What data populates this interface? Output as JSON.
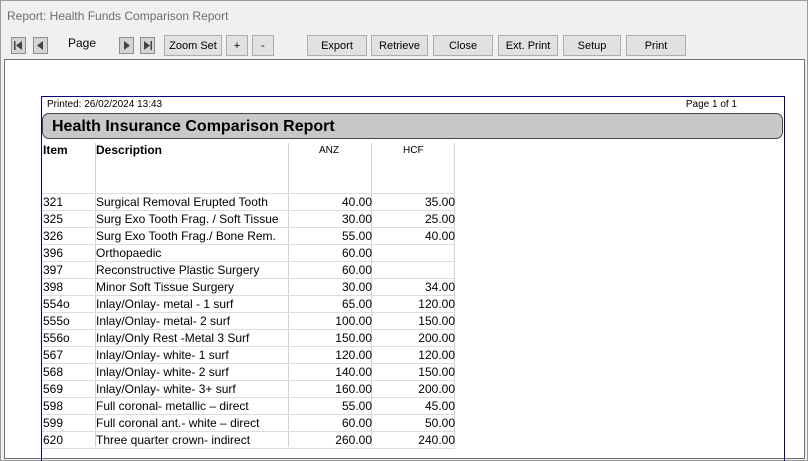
{
  "window": {
    "title": "Report: Health Funds Comparison Report"
  },
  "toolbar": {
    "page_label": "Page",
    "zoom_set": "Zoom Set",
    "zoom_in": "+",
    "zoom_out": "-",
    "export": "Export",
    "retrieve": "Retrieve",
    "close": "Close",
    "ext_print": "Ext. Print",
    "setup": "Setup",
    "print": "Print"
  },
  "report": {
    "printed": "Printed: 26/02/2024 13:43",
    "page_of": "Page 1 of 1",
    "title": "Health Insurance Comparison Report",
    "columns": {
      "item": "Item",
      "description": "Description",
      "anz": "ANZ",
      "hcf": "HCF"
    },
    "rows": [
      {
        "item": "321",
        "description": "Surgical Removal Erupted Tooth",
        "anz": "40.00",
        "hcf": "35.00"
      },
      {
        "item": "325",
        "description": "Surg Exo Tooth Frag. / Soft Tissue",
        "anz": "30.00",
        "hcf": "25.00"
      },
      {
        "item": "326",
        "description": "Surg Exo Tooth Frag./ Bone Rem.",
        "anz": "55.00",
        "hcf": "40.00"
      },
      {
        "item": "396",
        "description": "Orthopaedic",
        "anz": "60.00",
        "hcf": ""
      },
      {
        "item": "397",
        "description": "Reconstructive Plastic Surgery",
        "anz": "60.00",
        "hcf": ""
      },
      {
        "item": "398",
        "description": "Minor Soft Tissue Surgery",
        "anz": "30.00",
        "hcf": "34.00"
      },
      {
        "item": "554o",
        "description": "Inlay/Onlay- metal - 1 surf",
        "anz": "65.00",
        "hcf": "120.00"
      },
      {
        "item": "555o",
        "description": "Inlay/Onlay- metal- 2 surf",
        "anz": "100.00",
        "hcf": "150.00"
      },
      {
        "item": "556o",
        "description": "Inlay/Only Rest -Metal 3 Surf",
        "anz": "150.00",
        "hcf": "200.00"
      },
      {
        "item": "567",
        "description": "Inlay/Onlay- white- 1 surf",
        "anz": "120.00",
        "hcf": "120.00"
      },
      {
        "item": "568",
        "description": "Inlay/Onlay- white- 2 surf",
        "anz": "140.00",
        "hcf": "150.00"
      },
      {
        "item": "569",
        "description": "Inlay/Onlay- white- 3+ surf",
        "anz": "160.00",
        "hcf": "200.00"
      },
      {
        "item": "598",
        "description": "Full coronal- metallic  – direct",
        "anz": "55.00",
        "hcf": "45.00"
      },
      {
        "item": "599",
        "description": "Full coronal ant.- white  – direct",
        "anz": "60.00",
        "hcf": "50.00"
      },
      {
        "item": "620",
        "description": "Three quarter crown- indirect",
        "anz": "260.00",
        "hcf": "240.00"
      }
    ]
  }
}
